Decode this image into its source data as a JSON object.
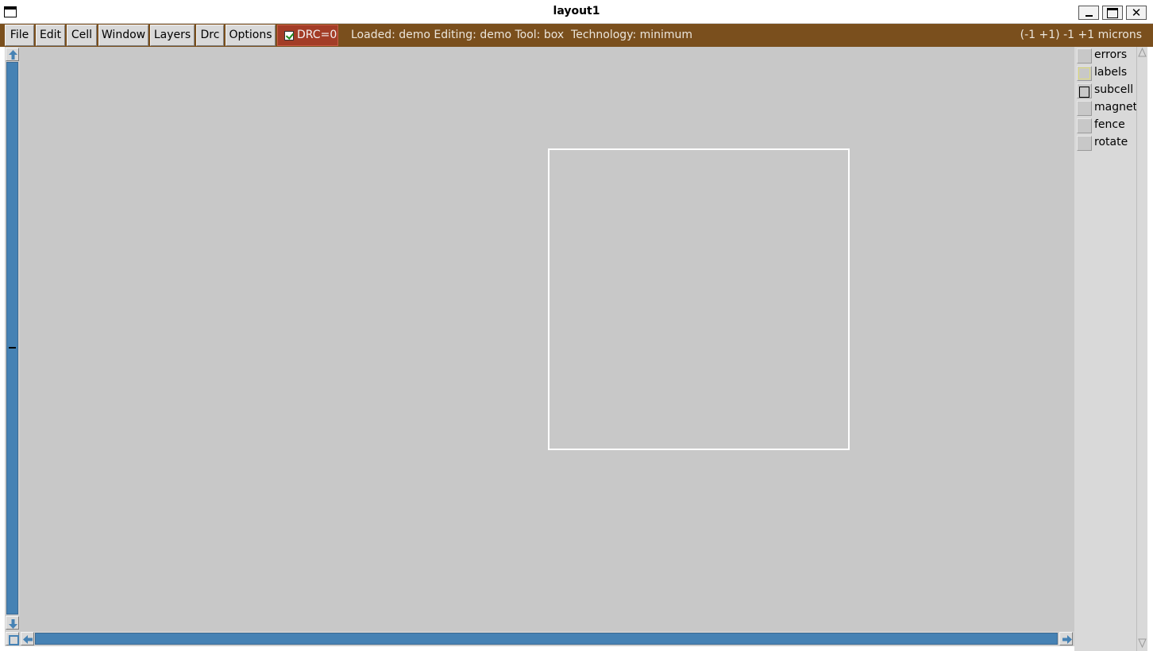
{
  "window": {
    "title": "layout1"
  },
  "menu": {
    "items": [
      "File",
      "Edit",
      "Cell",
      "Window",
      "Layers",
      "Drc",
      "Options"
    ]
  },
  "drc": {
    "label": "DRC=0",
    "checked": true
  },
  "status": {
    "text": "Loaded: demo Editing: demo Tool: box  Technology: minimum",
    "coordinates": "(-1 +1) -1 +1 microns"
  },
  "layers": {
    "items": [
      {
        "name": "errors",
        "swatch": "plain"
      },
      {
        "name": "labels",
        "swatch": "yellow-outline"
      },
      {
        "name": "subcell",
        "swatch": "box-outline"
      },
      {
        "name": "magnet",
        "swatch": "plain"
      },
      {
        "name": "fence",
        "swatch": "plain"
      },
      {
        "name": "rotate",
        "swatch": "plain"
      }
    ]
  },
  "colors": {
    "menubar": "#7a4f1d",
    "drc_background": "#a33d27",
    "canvas": "#c8c8c8",
    "scrollbar_track": "#4682b4",
    "cursor_box": "#ffffff"
  },
  "icons": {
    "up": "arrow-up-icon",
    "down": "arrow-down-icon",
    "left": "arrow-left-icon",
    "right": "arrow-right-icon",
    "zoom": "zoom-box-icon"
  }
}
